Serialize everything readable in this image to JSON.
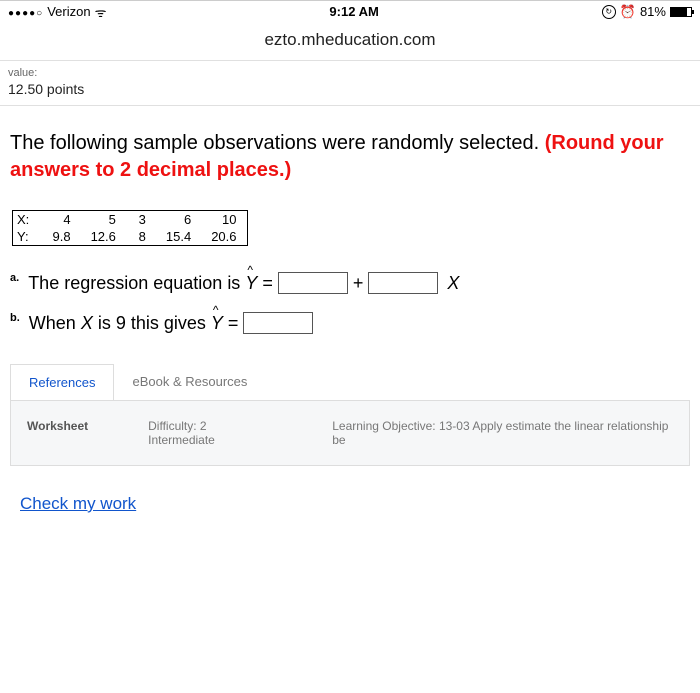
{
  "status_bar": {
    "carrier": "Verizon",
    "time": "9:12 AM",
    "battery_pct": "81%"
  },
  "url": "ezto.mheducation.com",
  "value": {
    "label": "value:",
    "points": "12.50 points"
  },
  "prompt": {
    "plain": "The following sample observations were randomly selected. ",
    "red": "(Round your answers to 2 decimal places.)"
  },
  "table": {
    "row1_label": "X:",
    "row2_label": "Y:",
    "x": [
      "4",
      "5",
      "3",
      "6",
      "10"
    ],
    "y": [
      "9.8",
      "12.6",
      "8",
      "15.4",
      "20.6"
    ]
  },
  "qa": {
    "a_label": "a.",
    "a_text": "The regression equation is ",
    "yhat": "Y",
    "eq": " = ",
    "plus": "+",
    "xvar": "X",
    "b_label": "b.",
    "b_text_1": "When ",
    "b_x": "X",
    "b_text_2": " is 9 this gives ",
    "b_eq": " = "
  },
  "tabs": {
    "ref": "References",
    "ebook": "eBook & Resources"
  },
  "tab_body": {
    "worksheet": "Worksheet",
    "difficulty": "Difficulty: 2 Intermediate",
    "objective": "Learning Objective: 13-03 Apply estimate the linear relationship be"
  },
  "check": "Check my work"
}
